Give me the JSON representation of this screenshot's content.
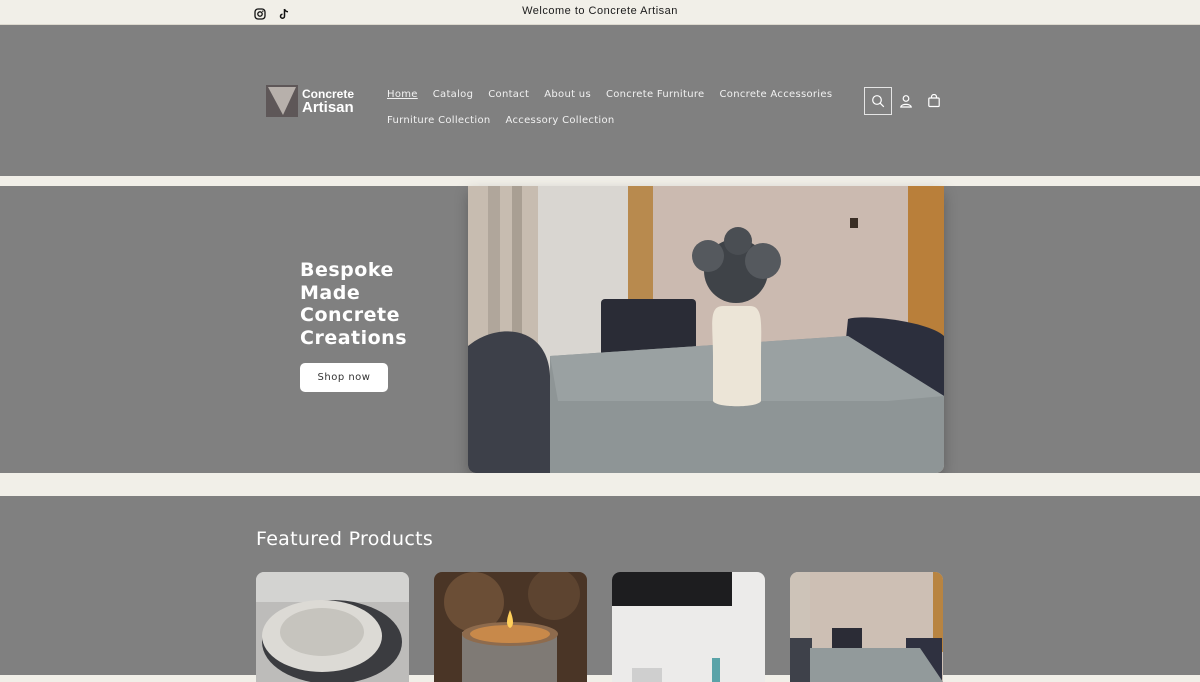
{
  "announcement": {
    "message": "Welcome to Concrete Artisan",
    "social": [
      "instagram-icon",
      "tiktok-icon"
    ]
  },
  "header": {
    "logo": {
      "line1": "Concrete",
      "line2": "Artisan"
    },
    "nav_row1": [
      {
        "label": "Home",
        "active": true
      },
      {
        "label": "Catalog"
      },
      {
        "label": "Contact"
      },
      {
        "label": "About us"
      },
      {
        "label": "Concrete Furniture"
      },
      {
        "label": "Concrete Accessories"
      }
    ],
    "nav_row2": [
      {
        "label": "Furniture Collection"
      },
      {
        "label": "Accessory Collection"
      }
    ],
    "icons": [
      "search-icon",
      "account-icon",
      "cart-icon"
    ]
  },
  "hero": {
    "heading": "Bespoke Made Concrete Creations",
    "button": "Shop now"
  },
  "featured": {
    "title": "Featured Products"
  },
  "colors": {
    "panel": "#808080",
    "band": "#f1efe8",
    "text_light": "#ffffff"
  }
}
